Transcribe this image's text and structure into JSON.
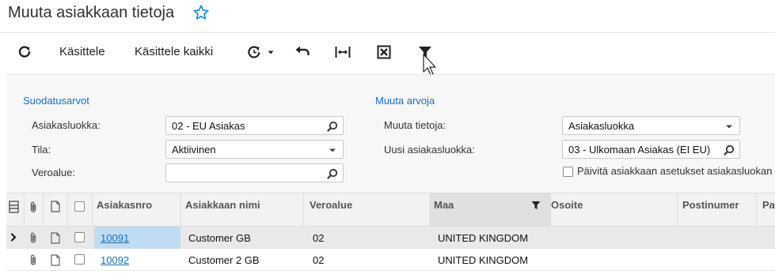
{
  "page": {
    "title": "Muuta asiakkaan tietoja"
  },
  "toolbar": {
    "process_label": "Käsittele",
    "process_all_label": "Käsittele kaikki"
  },
  "filter_section": {
    "header": "Suodatusarvot",
    "customer_class_label": "Asiakasluokka:",
    "customer_class_value": "02 - EU Asiakas",
    "status_label": "Tila:",
    "status_value": "Aktiivinen",
    "tax_zone_label": "Veroalue:",
    "tax_zone_value": ""
  },
  "change_section": {
    "header": "Muuta arvoja",
    "change_info_label": "Muuta tietoja:",
    "change_info_value": "Asiakasluokka",
    "new_class_label": "Uusi asiakasluokka:",
    "new_class_value": "03 - Ulkomaan Asiakas (EI EU)",
    "update_settings_label": "Päivitä asiakkaan asetukset asiakasluokan"
  },
  "grid": {
    "columns": [
      "Asiakasnro",
      "Asiakkaan nimi",
      "Veroalue",
      "Maa",
      "Osoite",
      "Postinumer",
      "Pa"
    ],
    "rows": [
      {
        "id": "10091",
        "name": "Customer GB",
        "tax_zone": "02",
        "country": "UNITED KINGDOM",
        "selected": true
      },
      {
        "id": "10092",
        "name": "Customer 2 GB",
        "tax_zone": "02",
        "country": "UNITED KINGDOM",
        "selected": false
      }
    ]
  },
  "colors": {
    "accent": "#1c6fb6",
    "star": "#1c8ad9",
    "panel_bg": "#f7f7f7",
    "selected_cell": "#bfdcf3"
  }
}
